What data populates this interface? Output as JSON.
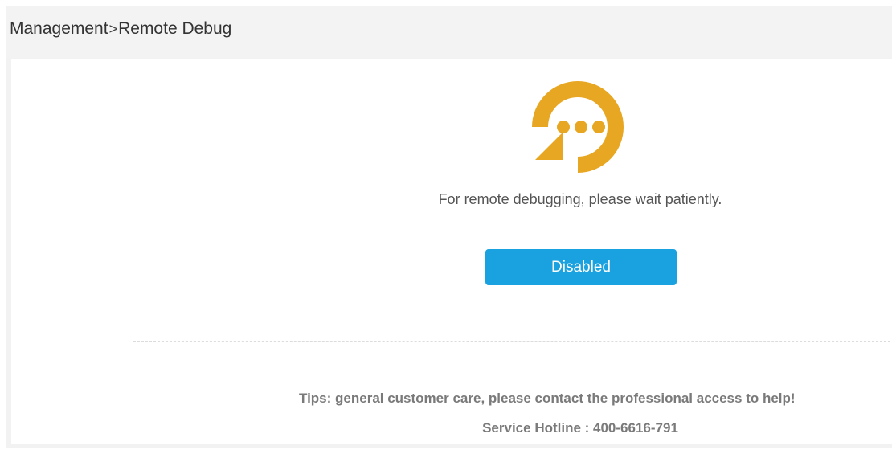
{
  "breadcrumb": {
    "parent": "Management",
    "separator": ">",
    "current": "Remote Debug"
  },
  "status": {
    "icon": "remote-debug-icon",
    "message": "For remote debugging, please wait patiently."
  },
  "debug_button": {
    "label": "Disabled"
  },
  "footer": {
    "tips": "Tips: general customer care, please contact the professional access to help!",
    "hotline": "Service Hotline : 400-6616-791"
  },
  "colors": {
    "accent": "#1aa1df",
    "icon": "#e8a722",
    "header_bg": "#f3f3f4"
  }
}
